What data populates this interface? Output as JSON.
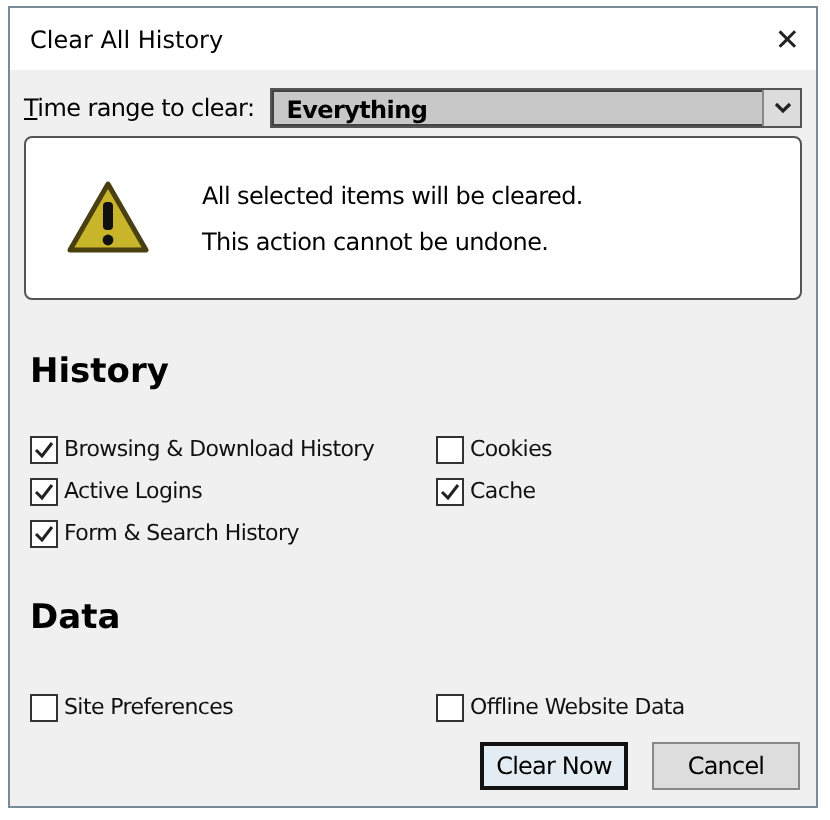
{
  "window": {
    "title": "Clear All History",
    "close": "✕"
  },
  "time_range": {
    "label": "Time range to clear:",
    "value": "Everything"
  },
  "warning": {
    "lines": [
      "All selected items will be cleared.",
      "This action cannot be undone."
    ]
  },
  "sections": [
    {
      "heading": "History",
      "items": [
        {
          "label": "Browsing & Download History",
          "checked": true
        },
        {
          "label": "Cookies",
          "checked": false
        },
        {
          "label": "Active Logins",
          "checked": true
        },
        {
          "label": "Cache",
          "checked": true
        },
        {
          "label": "Form & Search History",
          "checked": true
        }
      ]
    },
    {
      "heading": "Data",
      "items": [
        {
          "label": "Site Preferences",
          "checked": false
        },
        {
          "label": "Offline Website Data",
          "checked": false
        }
      ]
    }
  ],
  "buttons": [
    {
      "label": "Clear Now",
      "default": true
    },
    {
      "label": "Cancel",
      "default": false
    }
  ]
}
